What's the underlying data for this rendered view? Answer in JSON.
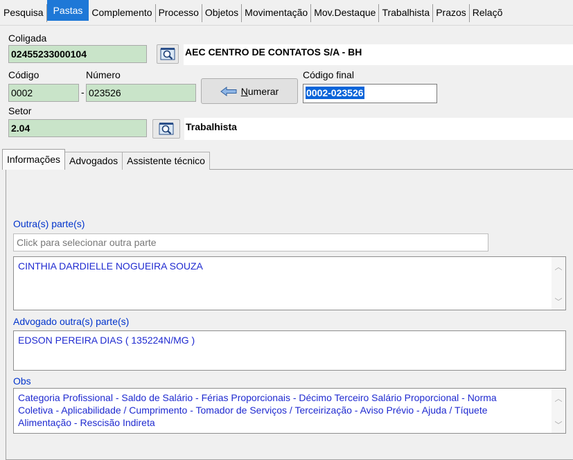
{
  "top_tabs": [
    {
      "label": "Pesquisa",
      "active": false
    },
    {
      "label": "Pastas",
      "active": true
    },
    {
      "label": "Complemento",
      "active": false
    },
    {
      "label": "Processo",
      "active": false
    },
    {
      "label": "Objetos",
      "active": false
    },
    {
      "label": "Movimentação",
      "active": false
    },
    {
      "label": "Mov.Destaque",
      "active": false
    },
    {
      "label": "Trabalhista",
      "active": false
    },
    {
      "label": "Prazos",
      "active": false
    },
    {
      "label": "Relaçõ",
      "active": false
    }
  ],
  "coligada": {
    "label": "Coligada",
    "value": "02455233000104",
    "name": "AEC CENTRO DE CONTATOS S/A - BH"
  },
  "codigo": {
    "label": "Código",
    "value": "0002"
  },
  "separator": "-",
  "numero": {
    "label": "Número",
    "value": "023526"
  },
  "numerar_button": {
    "label": "Numerar",
    "mnemonic": "N",
    "rest": "umerar"
  },
  "codigo_final": {
    "label": "Código final",
    "value": "0002-023526"
  },
  "setor": {
    "label": "Setor",
    "value": "2.04",
    "name": "Trabalhista"
  },
  "inner_tabs": [
    {
      "label": "Informações",
      "active": true
    },
    {
      "label": "Advogados",
      "active": false
    },
    {
      "label": "Assistente técnico",
      "active": false
    }
  ],
  "outras_partes": {
    "label": "Outra(s) parte(s)",
    "placeholder": "Click para selecionar outra parte",
    "value": "CINTHIA DARDIELLE NOGUEIRA SOUZA"
  },
  "advogado": {
    "label": "Advogado outra(s) parte(s)",
    "value": "EDSON PEREIRA DIAS ( 135224N/MG )"
  },
  "obs": {
    "label": "Obs",
    "lines": [
      "Categoria Profissional - Saldo de Salário - Férias Proporcionais - Décimo Terceiro Salário Proporcional - Norma",
      "Coletiva - Aplicabilidade / Cumprimento - Tomador de Serviços / Terceirização - Aviso Prévio - Ajuda / Tíquete",
      "Alimentação - Rescisão Indireta"
    ]
  },
  "colors": {
    "tab_active": "#1e78d7",
    "field_green": "#c9e4c9",
    "memo_text": "#1f2ad0",
    "label_blue": "#0033cc"
  }
}
